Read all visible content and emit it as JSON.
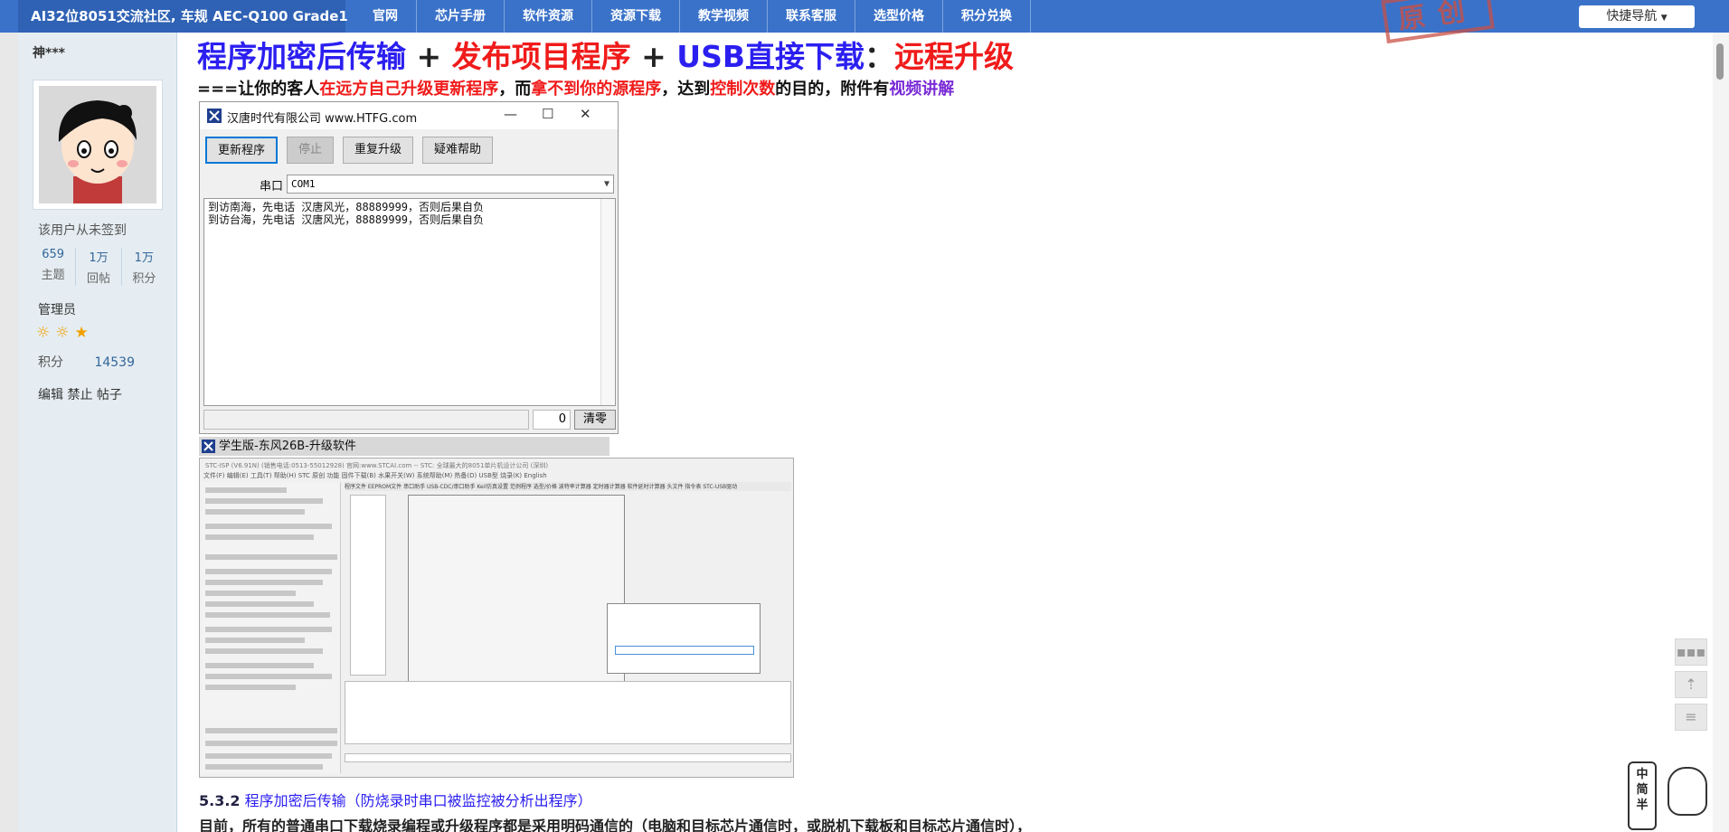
{
  "topbar": {
    "brand": "AI32位8051交流社区, 车规 AEC-Q100 Grade1",
    "nav": [
      "官网",
      "芯片手册",
      "软件资源",
      "资源下载",
      "教学视频",
      "联系客服",
      "选型价格",
      "积分兑换"
    ],
    "quick_nav": "快捷导航",
    "stamp_text": "原创"
  },
  "user": {
    "name": "神***",
    "signin_status": "该用户从未签到",
    "stats": [
      {
        "value": "659",
        "label": "主题"
      },
      {
        "value": "1万",
        "label": "回帖"
      },
      {
        "value": "1万",
        "label": "积分"
      }
    ],
    "role": "管理员",
    "points_label": "积分",
    "points_value": "14539",
    "actions": "编辑 禁止 帖子"
  },
  "post": {
    "headline": {
      "p1": "程序加密后传输",
      "p2": " + ",
      "p3": "发布项目程序",
      "p4": " + ",
      "p5": "USB直接下载",
      "p6": "：",
      "p7": "远程升级"
    },
    "subline": {
      "p1": "===让你的客人",
      "p2": "在远方自己升级更新程序",
      "p3": "，而",
      "p4": "拿不到你的源程序",
      "p5": "，达到",
      "p6": "控制次数",
      "p7": "的目的，附件有",
      "p8": "视频讲解"
    },
    "app_window": {
      "title": "汉唐时代有限公司 www.HTFG.com",
      "min": "—",
      "max": "☐",
      "close": "✕",
      "btn_update": "更新程序",
      "btn_stop": "停止",
      "btn_repeat": "重复升级",
      "btn_help": "疑难帮助",
      "port_label": "串口",
      "port_value": "COM1",
      "text_line1": "到访南海，先电话 汉唐风光，88889999，否则后果自负",
      "text_line2": "到访台海，先电话 汉唐风光，88889999，否则后果自负",
      "counter": "0",
      "btn_clear": "清零"
    },
    "caption": "学生版-东风26B-升级软件",
    "stc_title": "STC-ISP (V6.91N) (销售电话:0513-55012928) 官网:www.STCAI.com -- STC: 全球最大的8051单片机设计公司 (深圳)",
    "stc_menu": "文件(F)  编辑(E)  工具(T)  帮助(H)  STC 原创 功能  固件下载(B)  水果开关(W)  系统帮助(M)  热备(D)  USB型 烧录(K)  English",
    "stc_tabs": "程序文件  EEPROM文件  串口助手  USB-CDC/串口助手  Keil仿真设置  范例程序  选型/价格  波特率计算器  定时器计算器  软件延时计算器  头文件  指令表  STC-USB驱动",
    "section_title_num": "5.3.2",
    "section_title": " 程序加密后传输（防烧录时串口被监控被分析出程序）",
    "description": "目前，所有的普通串口下载烧录编程或升级程序都是采用明码通信的（电脑和目标芯片通信时，或脱机下载板和目标芯片通信时），"
  },
  "float_mascot": {
    "line1": "中",
    "line2": "简",
    "line3": "半"
  },
  "colors": {
    "topbar": "#3a72c9",
    "headline_blue": "#2b1ff0",
    "headline_red": "#f01b1b",
    "sidebar_bg": "#e5edf2"
  },
  "icons": [
    "chat-icon",
    "back-to-top-icon",
    "list-icon",
    "chevron-down-icon",
    "app-logo-icon"
  ]
}
